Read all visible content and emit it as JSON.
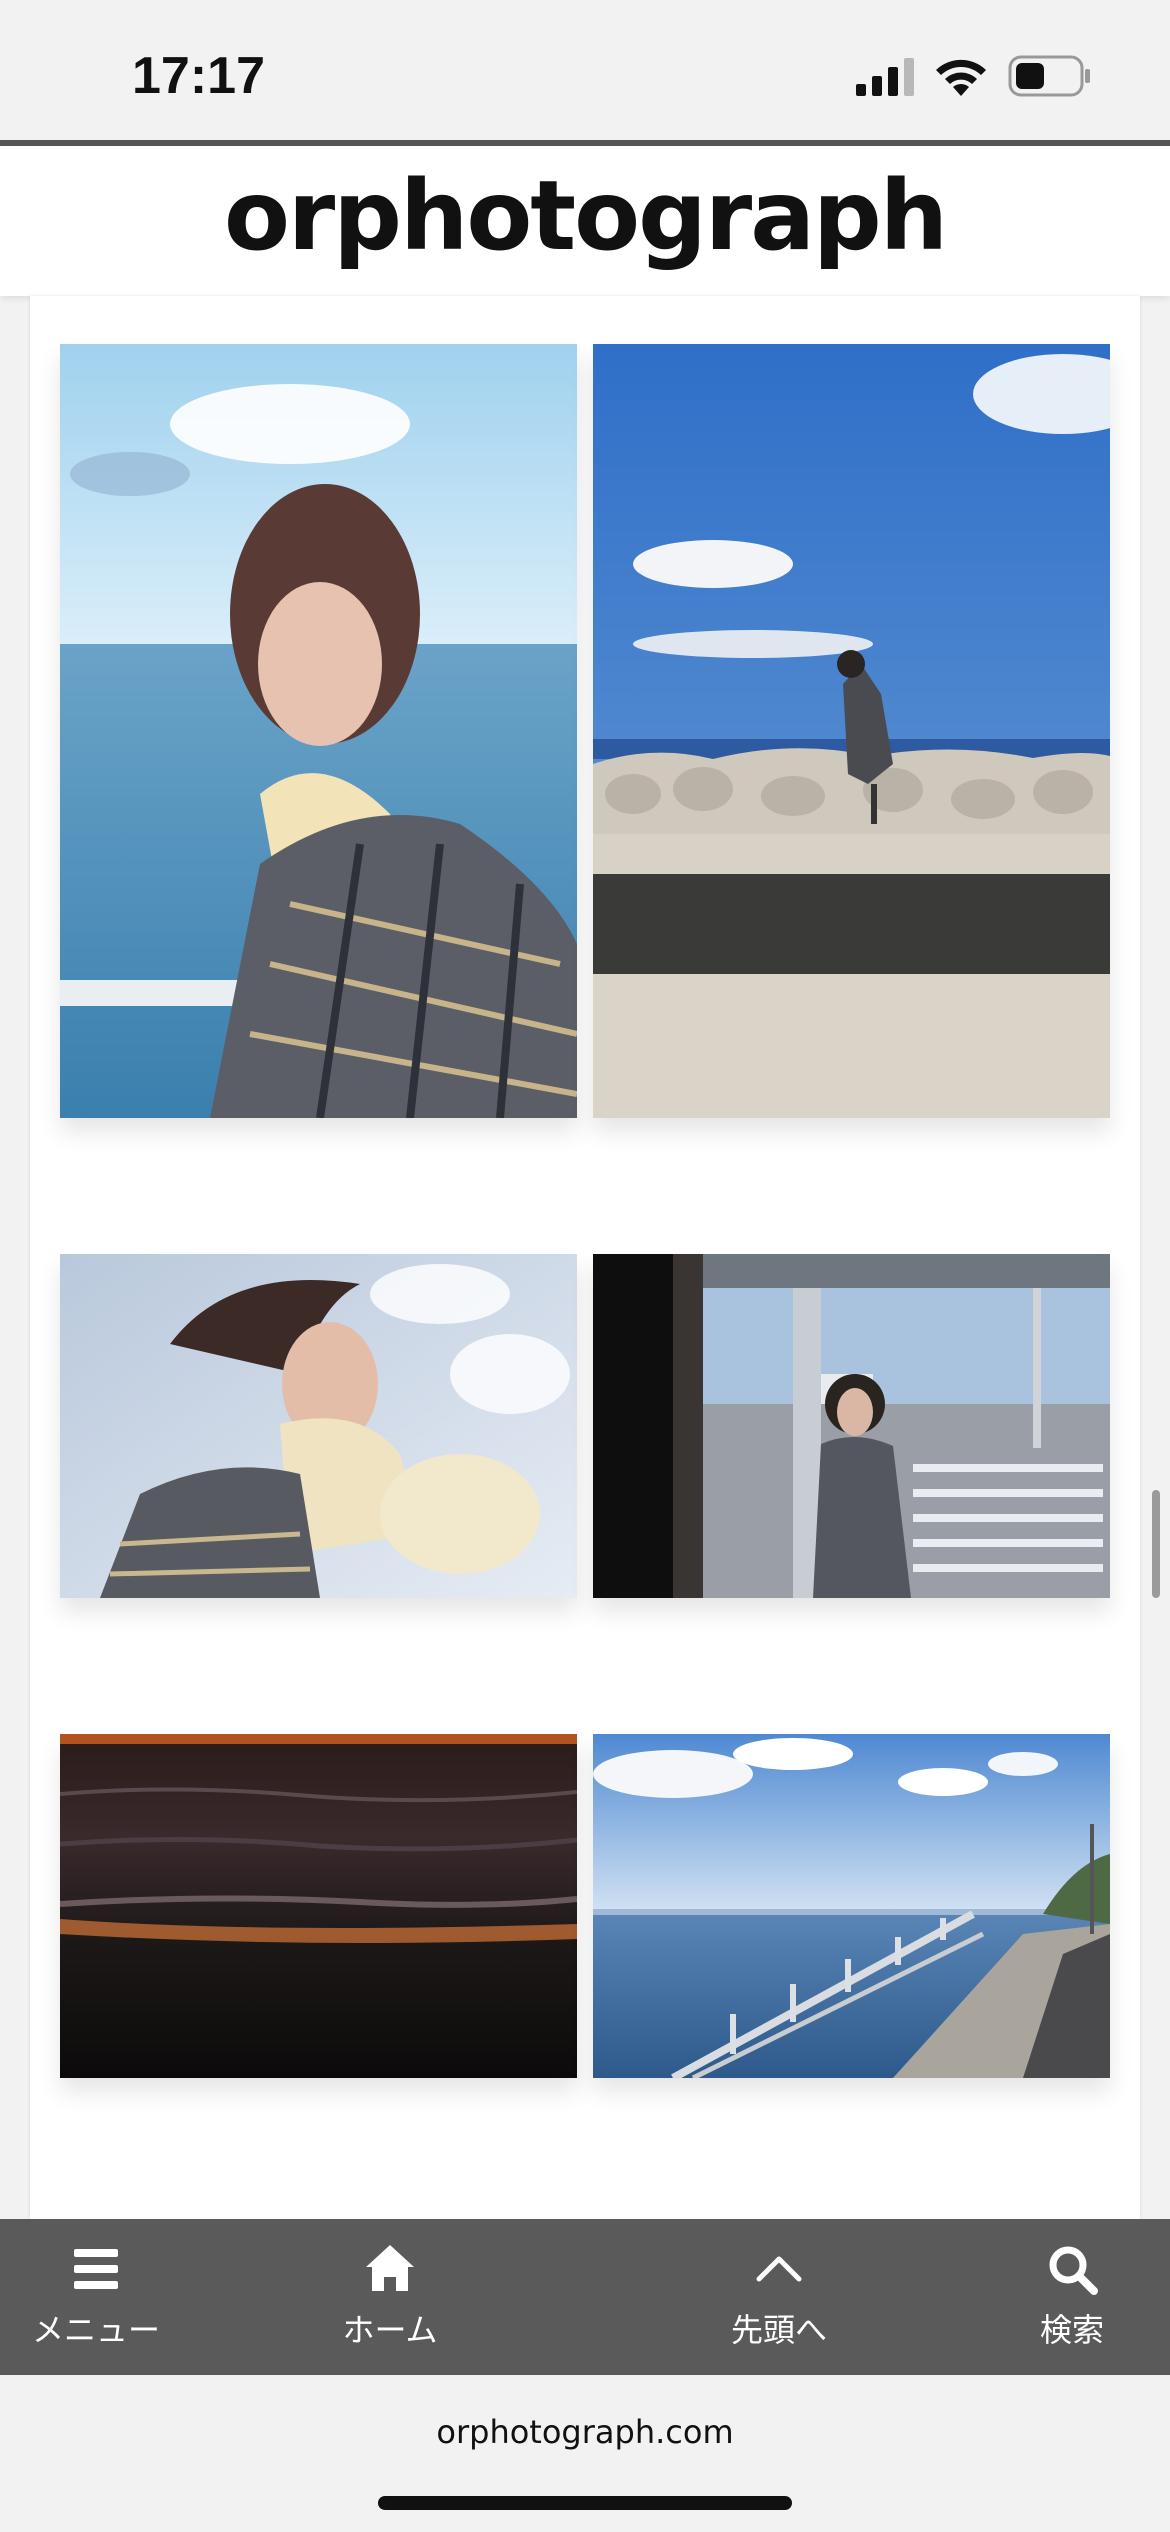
{
  "status_bar": {
    "time": "17:17",
    "icons": [
      "cellular-signal-icon",
      "wifi-icon",
      "battery-icon"
    ]
  },
  "header": {
    "site_title": "orphotograph"
  },
  "gallery": {
    "photos": [
      {
        "name": "photo-woman-smiling-by-sea"
      },
      {
        "name": "photo-woman-on-seawall"
      },
      {
        "name": "photo-woman-hair-in-wind"
      },
      {
        "name": "photo-woman-at-bus-stop"
      },
      {
        "name": "photo-sunset-waves"
      },
      {
        "name": "photo-seaside-promenade"
      }
    ]
  },
  "bottom_nav": {
    "items": [
      {
        "label": "メニュー",
        "icon": "hamburger-menu-icon"
      },
      {
        "label": "ホーム",
        "icon": "home-icon"
      },
      {
        "label": "先頭へ",
        "icon": "chevron-up-icon"
      },
      {
        "label": "検索",
        "icon": "search-icon"
      }
    ]
  },
  "browser": {
    "url": "orphotograph.com"
  },
  "colors": {
    "nav_background": "#5a5a5a",
    "header_border": "#555555",
    "page_background": "#f2f2f2"
  }
}
